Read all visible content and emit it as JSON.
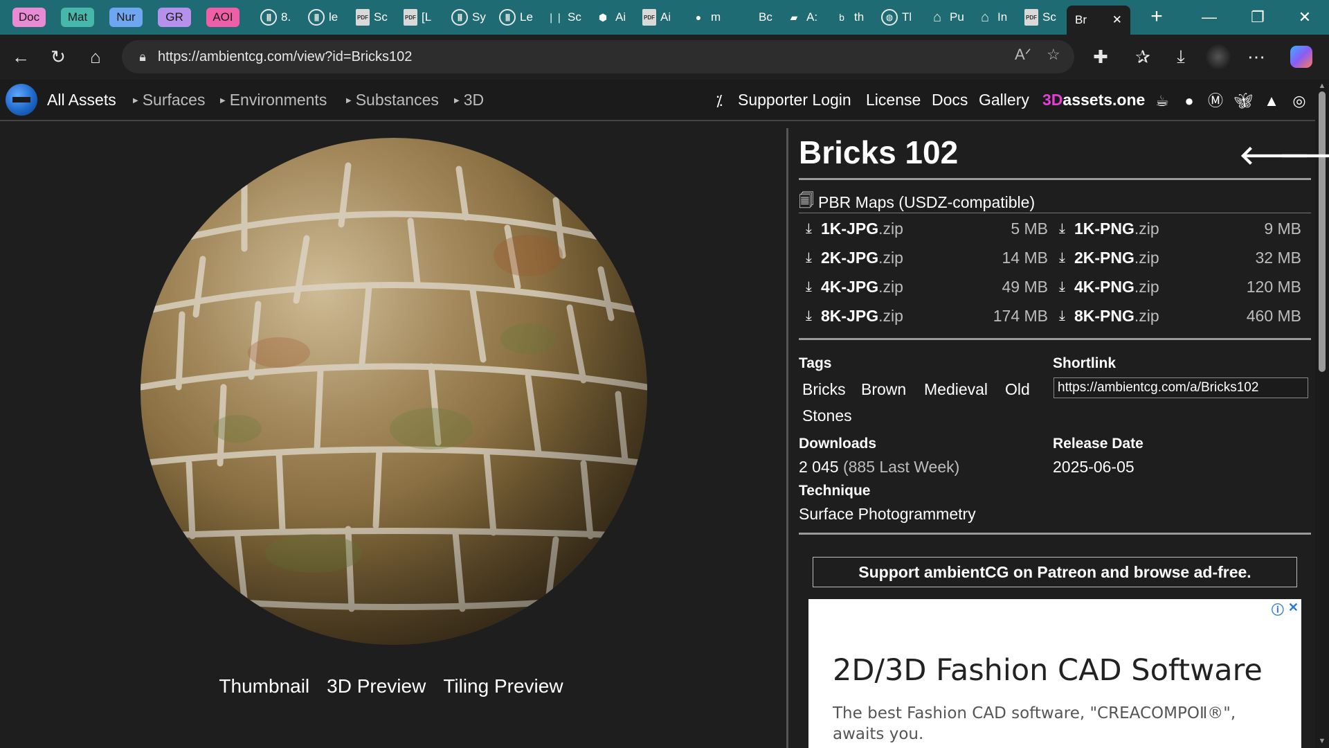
{
  "browser": {
    "pill_tabs": [
      {
        "label": "Doc",
        "color": "#e88ad4"
      },
      {
        "label": "Mat",
        "color": "#47b7a9"
      },
      {
        "label": "Nur",
        "color": "#6ea6f0"
      },
      {
        "label": "GR",
        "color": "#b591ec"
      },
      {
        "label": "AOI",
        "color": "#ef5fa8"
      }
    ],
    "mini_tabs": [
      {
        "icon": "bars-icon",
        "glyph": "|||",
        "label": "8."
      },
      {
        "icon": "bars-icon",
        "glyph": "|||",
        "label": "le"
      },
      {
        "icon": "pdf-icon",
        "glyph": "PDF",
        "label": "Sc"
      },
      {
        "icon": "pdf-icon",
        "glyph": "PDF",
        "label": "[L"
      },
      {
        "icon": "bars-icon",
        "glyph": "|||",
        "label": "Sy"
      },
      {
        "icon": "bars-icon",
        "glyph": "|||",
        "label": "Le"
      },
      {
        "icon": "leaf-icon",
        "glyph": "❘❘",
        "label": "Sc"
      },
      {
        "icon": "cube-icon",
        "glyph": "⬢",
        "label": "Ai"
      },
      {
        "icon": "pdf-icon",
        "glyph": "PDF",
        "label": "Ai"
      },
      {
        "icon": "github-icon",
        "glyph": "●",
        "label": "m"
      },
      {
        "icon": "blank-icon",
        "glyph": "",
        "label": "Bc"
      },
      {
        "icon": "book-icon",
        "glyph": "▰",
        "label": "A:"
      },
      {
        "icon": "bing-icon",
        "glyph": "b",
        "label": "th"
      },
      {
        "icon": "globe-icon",
        "glyph": "◍",
        "label": "Tl"
      },
      {
        "icon": "institution-icon",
        "glyph": "⌂",
        "label": "Pu"
      },
      {
        "icon": "institution-icon",
        "glyph": "⌂",
        "label": "In"
      },
      {
        "icon": "pdf-icon",
        "glyph": "PDF",
        "label": "Sc"
      }
    ],
    "active_tab": {
      "label": "Br",
      "close": "✕"
    },
    "new_tab": "+",
    "window": {
      "minimize": "—",
      "restore": "❐",
      "close": "✕"
    },
    "url": "https://ambientcg.com/view?id=Bricks102"
  },
  "site": {
    "nav": {
      "all_assets": "All Assets",
      "categories": [
        "Surfaces",
        "Environments",
        "Substances",
        "3D"
      ],
      "supporter_login": "Supporter Login",
      "license": "License",
      "docs": "Docs",
      "gallery": "Gallery",
      "threed_prefix": "3D",
      "threed_suffix": "assets.one"
    }
  },
  "asset": {
    "title": "Bricks 102",
    "prev": "🡐",
    "next": "🡒",
    "pbr_heading": "PBR Maps (USDZ-compatible)",
    "downloads_left": [
      {
        "name": "1K-JPG",
        "ext": ".zip",
        "size": "5 MB"
      },
      {
        "name": "2K-JPG",
        "ext": ".zip",
        "size": "14 MB"
      },
      {
        "name": "4K-JPG",
        "ext": ".zip",
        "size": "49 MB"
      },
      {
        "name": "8K-JPG",
        "ext": ".zip",
        "size": "174 MB"
      }
    ],
    "downloads_right": [
      {
        "name": "1K-PNG",
        "ext": ".zip",
        "size": "9 MB"
      },
      {
        "name": "2K-PNG",
        "ext": ".zip",
        "size": "32 MB"
      },
      {
        "name": "4K-PNG",
        "ext": ".zip",
        "size": "120 MB"
      },
      {
        "name": "8K-PNG",
        "ext": ".zip",
        "size": "460 MB"
      }
    ],
    "tags_label": "Tags",
    "tags": [
      "Bricks",
      "Brown",
      "Medieval",
      "Old",
      "Stones"
    ],
    "shortlink_label": "Shortlink",
    "shortlink": "https://ambientcg.com/a/Bricks102",
    "downloads_label": "Downloads",
    "downloads_count": "2 045",
    "downloads_week": "(885 Last Week)",
    "release_label": "Release Date",
    "release_date": "2025-06-05",
    "technique_label": "Technique",
    "technique": "Surface Photogrammetry",
    "views": [
      "Thumbnail",
      "3D Preview",
      "Tiling Preview"
    ],
    "patreon": "Support ambientCG on Patreon and browse ad-free."
  },
  "ad": {
    "title": "2D/3D Fashion CAD Software",
    "text": "The best Fashion CAD software, \"CREACOMPOⅡ®\", awaits you.",
    "info": "ⓘ",
    "close": "✕"
  }
}
